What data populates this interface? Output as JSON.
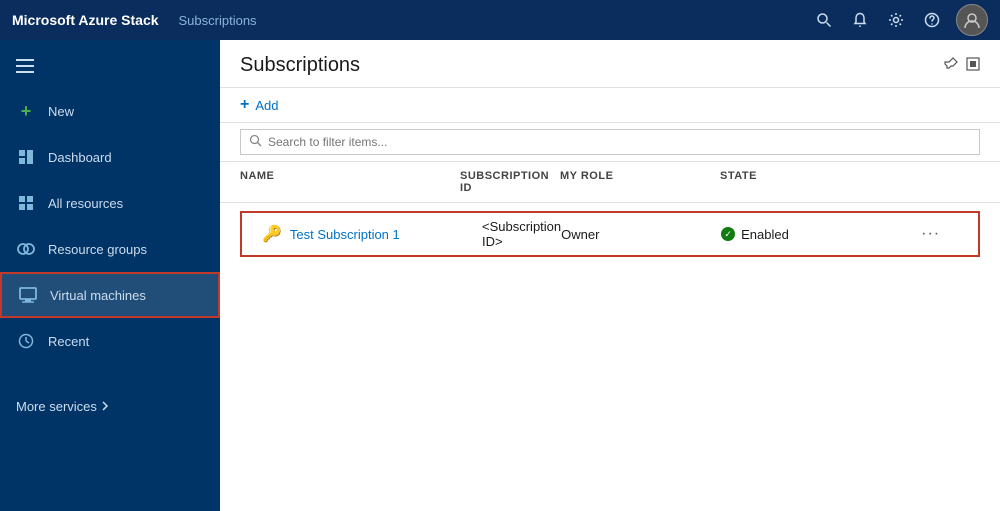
{
  "topbar": {
    "brand": "Microsoft Azure Stack",
    "section_title": "Subscriptions",
    "icons": [
      "search",
      "bell",
      "settings",
      "help"
    ]
  },
  "sidebar": {
    "new_label": "New",
    "items": [
      {
        "id": "dashboard",
        "label": "Dashboard",
        "icon": "dashboard-icon"
      },
      {
        "id": "all-resources",
        "label": "All resources",
        "icon": "grid-icon"
      },
      {
        "id": "resource-groups",
        "label": "Resource groups",
        "icon": "resource-groups-icon"
      },
      {
        "id": "virtual-machines",
        "label": "Virtual machines",
        "icon": "vm-icon",
        "active": true
      },
      {
        "id": "recent",
        "label": "Recent",
        "icon": "clock-icon"
      }
    ],
    "more_services": "More services"
  },
  "content": {
    "title": "Subscriptions",
    "toolbar": {
      "add_label": "Add"
    },
    "search": {
      "placeholder": "Search to filter items..."
    },
    "table": {
      "columns": [
        "NAME",
        "SUBSCRIPTION ID",
        "MY ROLE",
        "STATE"
      ],
      "rows": [
        {
          "name": "Test Subscription 1",
          "subscription_id": "<Subscription ID>",
          "role": "Owner",
          "state": "Enabled"
        }
      ]
    }
  }
}
